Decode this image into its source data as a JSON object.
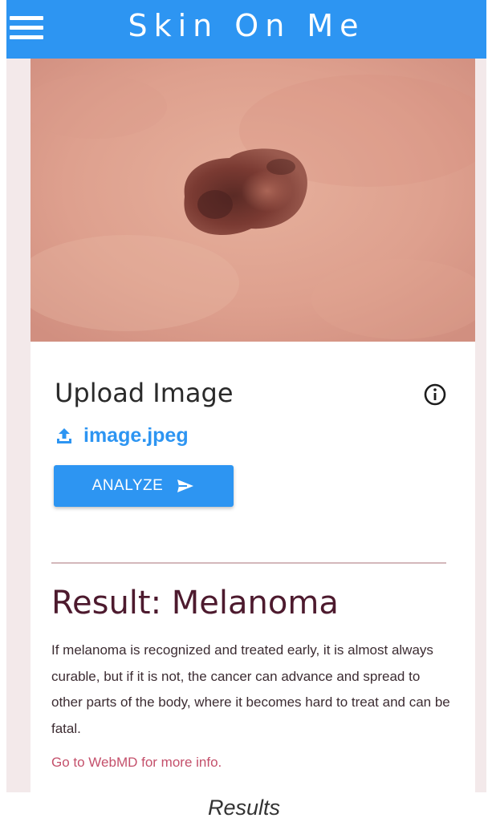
{
  "app_bar": {
    "title": "Skin On Me",
    "menu_icon": "hamburger-menu-icon",
    "color": "#2d95f2"
  },
  "upload": {
    "heading": "Upload Image",
    "info_icon": "info-icon",
    "file_icon": "upload-icon",
    "file_name": "image.jpeg",
    "analyze_label": "ANALYZE",
    "analyze_icon": "send-icon"
  },
  "result": {
    "title": "Result: Melanoma",
    "description": "If melanoma is recognized and treated early, it is almost always curable, but if it is not, the cancer can advance and spread to other parts of the body, where it becomes hard to treat and can be fatal.",
    "link_text": "Go to WebMD for more info.",
    "title_color": "#4d1a2e",
    "link_color": "#c4506b"
  },
  "caption": "Results"
}
